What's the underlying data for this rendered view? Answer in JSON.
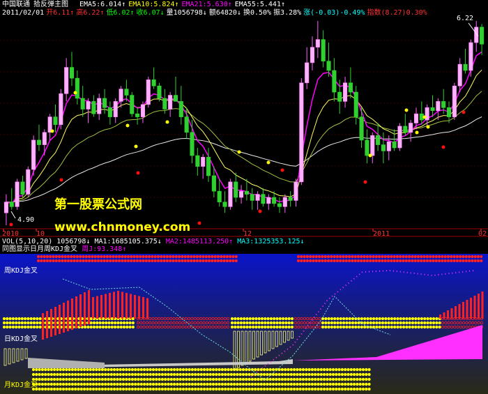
{
  "header": {
    "stock_name": "中国联通",
    "chart_title": "拾反弹主图",
    "ema_labels": [
      {
        "text": "EMA5:6.014↑",
        "color": "#ffffff"
      },
      {
        "text": "EMA10:5.824↑",
        "color": "#ffff00"
      },
      {
        "text": "EMA21:5.630↑",
        "color": "#ff00ff"
      },
      {
        "text": "EMA55:5.441↑",
        "color": "#ffffff"
      }
    ],
    "quote": {
      "date": "2011/02/01",
      "open": "开6.11↑",
      "high": "高6.22↑",
      "low": "低6.02↑",
      "close": "收6.07↓",
      "volume": "量1056798↓",
      "amount": "额64820↓",
      "turnover": "换0.50%",
      "amplitude": "振3.28%",
      "change": "涨(-0.03)-0.49%",
      "index": "指数(8.27)0.30%"
    },
    "colors": {
      "open": "#ff3030",
      "high": "#ff3030",
      "low": "#00ff00",
      "close": "#00ff00",
      "volume": "#ffffff",
      "amount": "#ffffff",
      "turnover": "#ffffff",
      "amplitude": "#ffffff",
      "change": "#00ffff",
      "index": "#ff3030"
    }
  },
  "main_chart": {
    "max_label": "6.22",
    "min_label": "4.90",
    "watermark": [
      "第一股票公式网",
      "www.chnmoney.com"
    ],
    "x_ticks": [
      "2010",
      "10",
      "12",
      "2011",
      "02"
    ]
  },
  "indicator": {
    "vol_label": "VOL(5,10,20)",
    "vol_value": "1056798↓",
    "ma1": "MA1:1685105.375↓",
    "ma2": "MA2:1485113.250↑",
    "ma3": "MA3:1325353.125↓",
    "title": "同图显示日月周KDJ金叉",
    "week_j": "周J:93.348↑",
    "labels": [
      "周KDJ金叉",
      "日KDJ金叉",
      "月KDJ金叉"
    ]
  },
  "chart_data": {
    "type": "candlestick",
    "title": "拾反弹主图",
    "series": [
      {
        "name": "中国联通",
        "values": [
          [
            4.98,
            5.1,
            4.9,
            5.05
          ],
          [
            5.05,
            5.14,
            5.0,
            5.02
          ],
          [
            5.02,
            5.2,
            5.0,
            5.18
          ],
          [
            5.18,
            5.22,
            5.08,
            5.1
          ],
          [
            5.1,
            5.28,
            5.08,
            5.26
          ],
          [
            5.26,
            5.48,
            5.22,
            5.45
          ],
          [
            5.45,
            5.55,
            5.38,
            5.42
          ],
          [
            5.42,
            5.52,
            5.35,
            5.5
          ],
          [
            5.5,
            5.62,
            5.45,
            5.6
          ],
          [
            5.6,
            5.68,
            5.5,
            5.55
          ],
          [
            5.55,
            5.78,
            5.52,
            5.75
          ],
          [
            5.75,
            5.98,
            5.7,
            5.92
          ],
          [
            5.92,
            6.02,
            5.8,
            5.85
          ],
          [
            5.85,
            5.9,
            5.68,
            5.72
          ],
          [
            5.72,
            5.8,
            5.6,
            5.65
          ],
          [
            5.65,
            5.72,
            5.56,
            5.7
          ],
          [
            5.7,
            5.74,
            5.6,
            5.62
          ],
          [
            5.62,
            5.75,
            5.58,
            5.72
          ],
          [
            5.72,
            5.78,
            5.62,
            5.66
          ],
          [
            5.66,
            5.7,
            5.55,
            5.6
          ],
          [
            5.6,
            5.72,
            5.56,
            5.7
          ],
          [
            5.7,
            5.8,
            5.66,
            5.78
          ],
          [
            5.78,
            5.84,
            5.7,
            5.74
          ],
          [
            5.74,
            5.76,
            5.6,
            5.62
          ],
          [
            5.62,
            5.66,
            5.55,
            5.6
          ],
          [
            5.6,
            5.7,
            5.56,
            5.68
          ],
          [
            5.68,
            5.86,
            5.66,
            5.84
          ],
          [
            5.84,
            5.92,
            5.78,
            5.8
          ],
          [
            5.8,
            5.82,
            5.7,
            5.72
          ],
          [
            5.72,
            5.78,
            5.62,
            5.65
          ],
          [
            5.65,
            5.76,
            5.6,
            5.74
          ],
          [
            5.74,
            5.86,
            5.7,
            5.7
          ],
          [
            5.7,
            5.8,
            5.55,
            5.6
          ],
          [
            5.6,
            5.66,
            5.46,
            5.5
          ],
          [
            5.5,
            5.58,
            5.3,
            5.35
          ],
          [
            5.35,
            5.4,
            5.22,
            5.28
          ],
          [
            5.28,
            5.36,
            5.2,
            5.34
          ],
          [
            5.34,
            5.4,
            5.18,
            5.22
          ],
          [
            5.22,
            5.28,
            5.08,
            5.12
          ],
          [
            5.12,
            5.2,
            5.02,
            5.05
          ],
          [
            5.05,
            5.12,
            4.98,
            5.02
          ],
          [
            5.02,
            5.2,
            5.0,
            5.18
          ],
          [
            5.18,
            5.24,
            5.05,
            5.08
          ],
          [
            5.08,
            5.16,
            5.04,
            5.12
          ],
          [
            5.12,
            5.2,
            5.06,
            5.1
          ],
          [
            5.1,
            5.14,
            5.0,
            5.06
          ],
          [
            5.06,
            5.12,
            5.0,
            5.1
          ],
          [
            5.1,
            5.14,
            5.02,
            5.04
          ],
          [
            5.04,
            5.1,
            5.0,
            5.08
          ],
          [
            5.08,
            5.12,
            5.02,
            5.04
          ],
          [
            5.04,
            5.08,
            4.98,
            5.02
          ],
          [
            5.02,
            5.1,
            4.98,
            5.08
          ],
          [
            5.08,
            5.12,
            5.02,
            5.06
          ],
          [
            5.06,
            5.2,
            5.02,
            5.18
          ],
          [
            5.18,
            5.85,
            5.16,
            5.82
          ],
          [
            5.82,
            6.05,
            5.78,
            5.95
          ],
          [
            5.95,
            6.12,
            5.9,
            6.05
          ],
          [
            6.05,
            6.22,
            5.98,
            6.1
          ],
          [
            6.1,
            6.16,
            5.92,
            5.96
          ],
          [
            5.96,
            6.08,
            5.86,
            5.9
          ],
          [
            5.9,
            5.98,
            5.7,
            5.76
          ],
          [
            5.76,
            5.84,
            5.62,
            5.7
          ],
          [
            5.7,
            5.86,
            5.66,
            5.82
          ],
          [
            5.82,
            5.92,
            5.72,
            5.76
          ],
          [
            5.76,
            5.8,
            5.55,
            5.6
          ],
          [
            5.6,
            5.66,
            5.4,
            5.45
          ],
          [
            5.45,
            5.52,
            5.3,
            5.35
          ],
          [
            5.35,
            5.5,
            5.3,
            5.48
          ],
          [
            5.48,
            5.56,
            5.38,
            5.42
          ],
          [
            5.42,
            5.5,
            5.3,
            5.38
          ],
          [
            5.38,
            5.48,
            5.32,
            5.44
          ],
          [
            5.44,
            5.52,
            5.38,
            5.4
          ],
          [
            5.4,
            5.56,
            5.38,
            5.54
          ],
          [
            5.54,
            5.62,
            5.48,
            5.5
          ],
          [
            5.5,
            5.58,
            5.44,
            5.56
          ],
          [
            5.56,
            5.66,
            5.52,
            5.62
          ],
          [
            5.62,
            5.7,
            5.55,
            5.58
          ],
          [
            5.58,
            5.68,
            5.54,
            5.66
          ],
          [
            5.66,
            5.74,
            5.6,
            5.64
          ],
          [
            5.64,
            5.72,
            5.58,
            5.7
          ],
          [
            5.7,
            5.78,
            5.62,
            5.66
          ],
          [
            5.66,
            5.7,
            5.56,
            5.6
          ],
          [
            5.6,
            5.82,
            5.58,
            5.8
          ],
          [
            5.8,
            5.98,
            5.76,
            5.94
          ],
          [
            5.94,
            6.04,
            5.88,
            5.9
          ],
          [
            5.9,
            6.1,
            5.86,
            6.08
          ],
          [
            6.08,
            6.22,
            6.02,
            6.18
          ],
          [
            6.18,
            6.2,
            6.0,
            6.07
          ]
        ]
      }
    ],
    "ylim": [
      4.9,
      6.22
    ]
  }
}
